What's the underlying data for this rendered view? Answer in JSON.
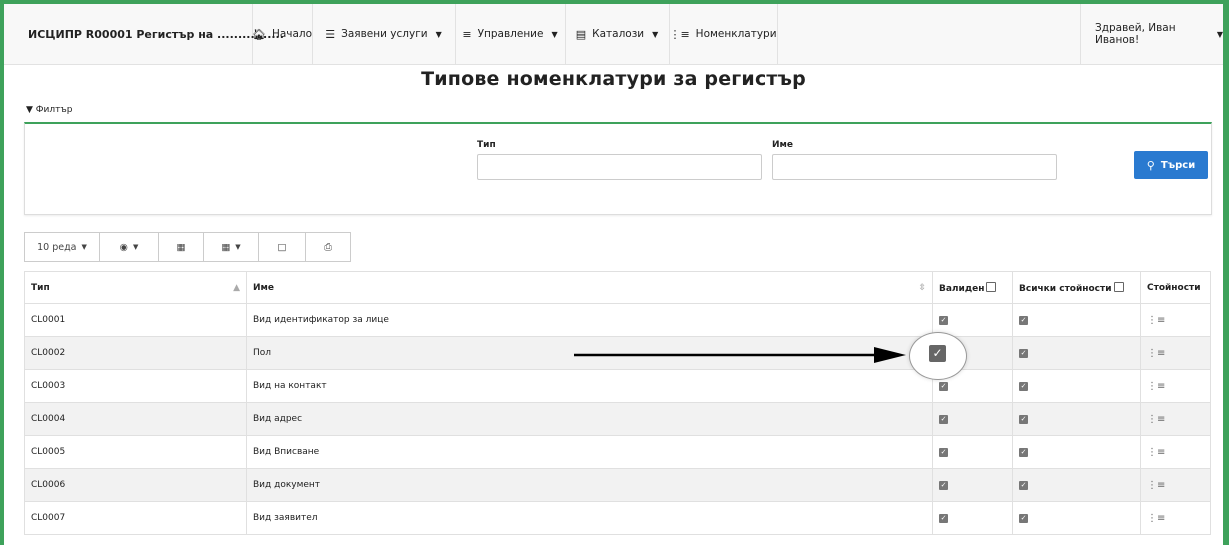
{
  "nav": {
    "brand": "ИСЦИПР R00001 Регистър на ................",
    "items": [
      {
        "label": "Начало",
        "icon": "home-icon"
      },
      {
        "label": "Заявени услуги",
        "icon": "layers-icon"
      },
      {
        "label": "Управление",
        "icon": "sliders-icon"
      },
      {
        "label": "Каталози",
        "icon": "catalog-icon"
      },
      {
        "label": "Номенклатури",
        "icon": "list-icon"
      }
    ],
    "greeting": "Здравей, Иван Иванов!"
  },
  "page_title": "Типове номенклатури за регистър",
  "filter": {
    "toggle_label": "Филтър",
    "type_label": "Тип",
    "type_value": "",
    "name_label": "Име",
    "name_value": "",
    "search_label": "Търси"
  },
  "toolbar": {
    "page_size_label": "10 реда"
  },
  "table": {
    "headers": [
      "Тип",
      "Име",
      "Валиден",
      "Всички стойности",
      "Стойности"
    ],
    "rows": [
      {
        "type": "CL0001",
        "name": "Вид идентификатор за лице",
        "valid": true,
        "all_values": true
      },
      {
        "type": "CL0002",
        "name": "Пол",
        "valid": true,
        "all_values": true
      },
      {
        "type": "CL0003",
        "name": "Вид на контакт",
        "valid": true,
        "all_values": true
      },
      {
        "type": "CL0004",
        "name": "Вид адрес",
        "valid": true,
        "all_values": true
      },
      {
        "type": "CL0005",
        "name": "Вид Вписване",
        "valid": true,
        "all_values": true
      },
      {
        "type": "CL0006",
        "name": "Вид документ",
        "valid": true,
        "all_values": true
      },
      {
        "type": "CL0007",
        "name": "Вид заявител",
        "valid": true,
        "all_values": true
      }
    ]
  },
  "colors": {
    "accent_green": "#3ea25b",
    "primary_blue": "#2a7ad0"
  }
}
